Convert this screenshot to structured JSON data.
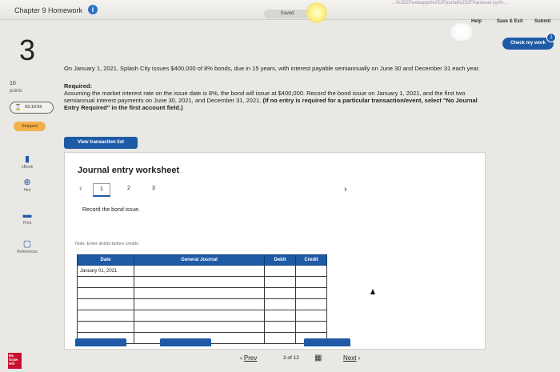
{
  "header": {
    "chapter_title": "Chapter 9 Homework",
    "info_icon": "i",
    "saved": "Saved",
    "url_fragment": "...%252Fwebapps%252Fportal%252Fframeset.jsp%...",
    "help": "Help",
    "save_exit": "Save & Exit",
    "submit": "Submit",
    "check_my_work": "Check my work",
    "check_badge": "1"
  },
  "question": {
    "number": "3",
    "points": "10",
    "points_label": "points",
    "timer": "03:19:55",
    "skipped": "Skipped"
  },
  "problem": {
    "text": "On January 1, 2021, Splash City issues $400,000 of 8% bonds, due in 15 years, with interest payable semiannually on June 30 and December 31 each year.",
    "required_label": "Required:",
    "required_text": "Assuming the market interest rate on the issue date is 8%, the bond will issue at $400,000. Record the bond issue on January 1, 2021, and the first two semiannual interest payments on June 30, 2021, and December 31, 2021.",
    "required_bold": "(If no entry is required for a particular transaction/event, select \"No Journal Entry Required\" in the first account field.)"
  },
  "sidebar": [
    {
      "name": "ebook",
      "icon": "book-icon",
      "label": "eBook"
    },
    {
      "name": "hint",
      "icon": "hint-icon",
      "label": "Hint"
    },
    {
      "name": "print",
      "icon": "print-icon",
      "label": "Print"
    },
    {
      "name": "references",
      "icon": "references-icon",
      "label": "References"
    }
  ],
  "view_transaction_list": "View transaction list",
  "worksheet": {
    "title": "Journal entry worksheet",
    "tabs": [
      "1",
      "2",
      "3"
    ],
    "active_tab": "1",
    "instruction": "Record the bond issue.",
    "note": "Note: Enter debits before credits.",
    "columns": [
      "Date",
      "General Journal",
      "Debit",
      "Credit"
    ],
    "rows": [
      [
        "January 01, 2021",
        "",
        "",
        ""
      ],
      [
        "",
        "",
        "",
        ""
      ],
      [
        "",
        "",
        "",
        ""
      ],
      [
        "",
        "",
        "",
        ""
      ],
      [
        "",
        "",
        "",
        ""
      ],
      [
        "",
        "",
        "",
        ""
      ],
      [
        "",
        "",
        "",
        ""
      ]
    ]
  },
  "pager": {
    "prev": "Prev",
    "count": "3 of 12",
    "next": "Next"
  },
  "logo_text": "Mc Graw Hill"
}
